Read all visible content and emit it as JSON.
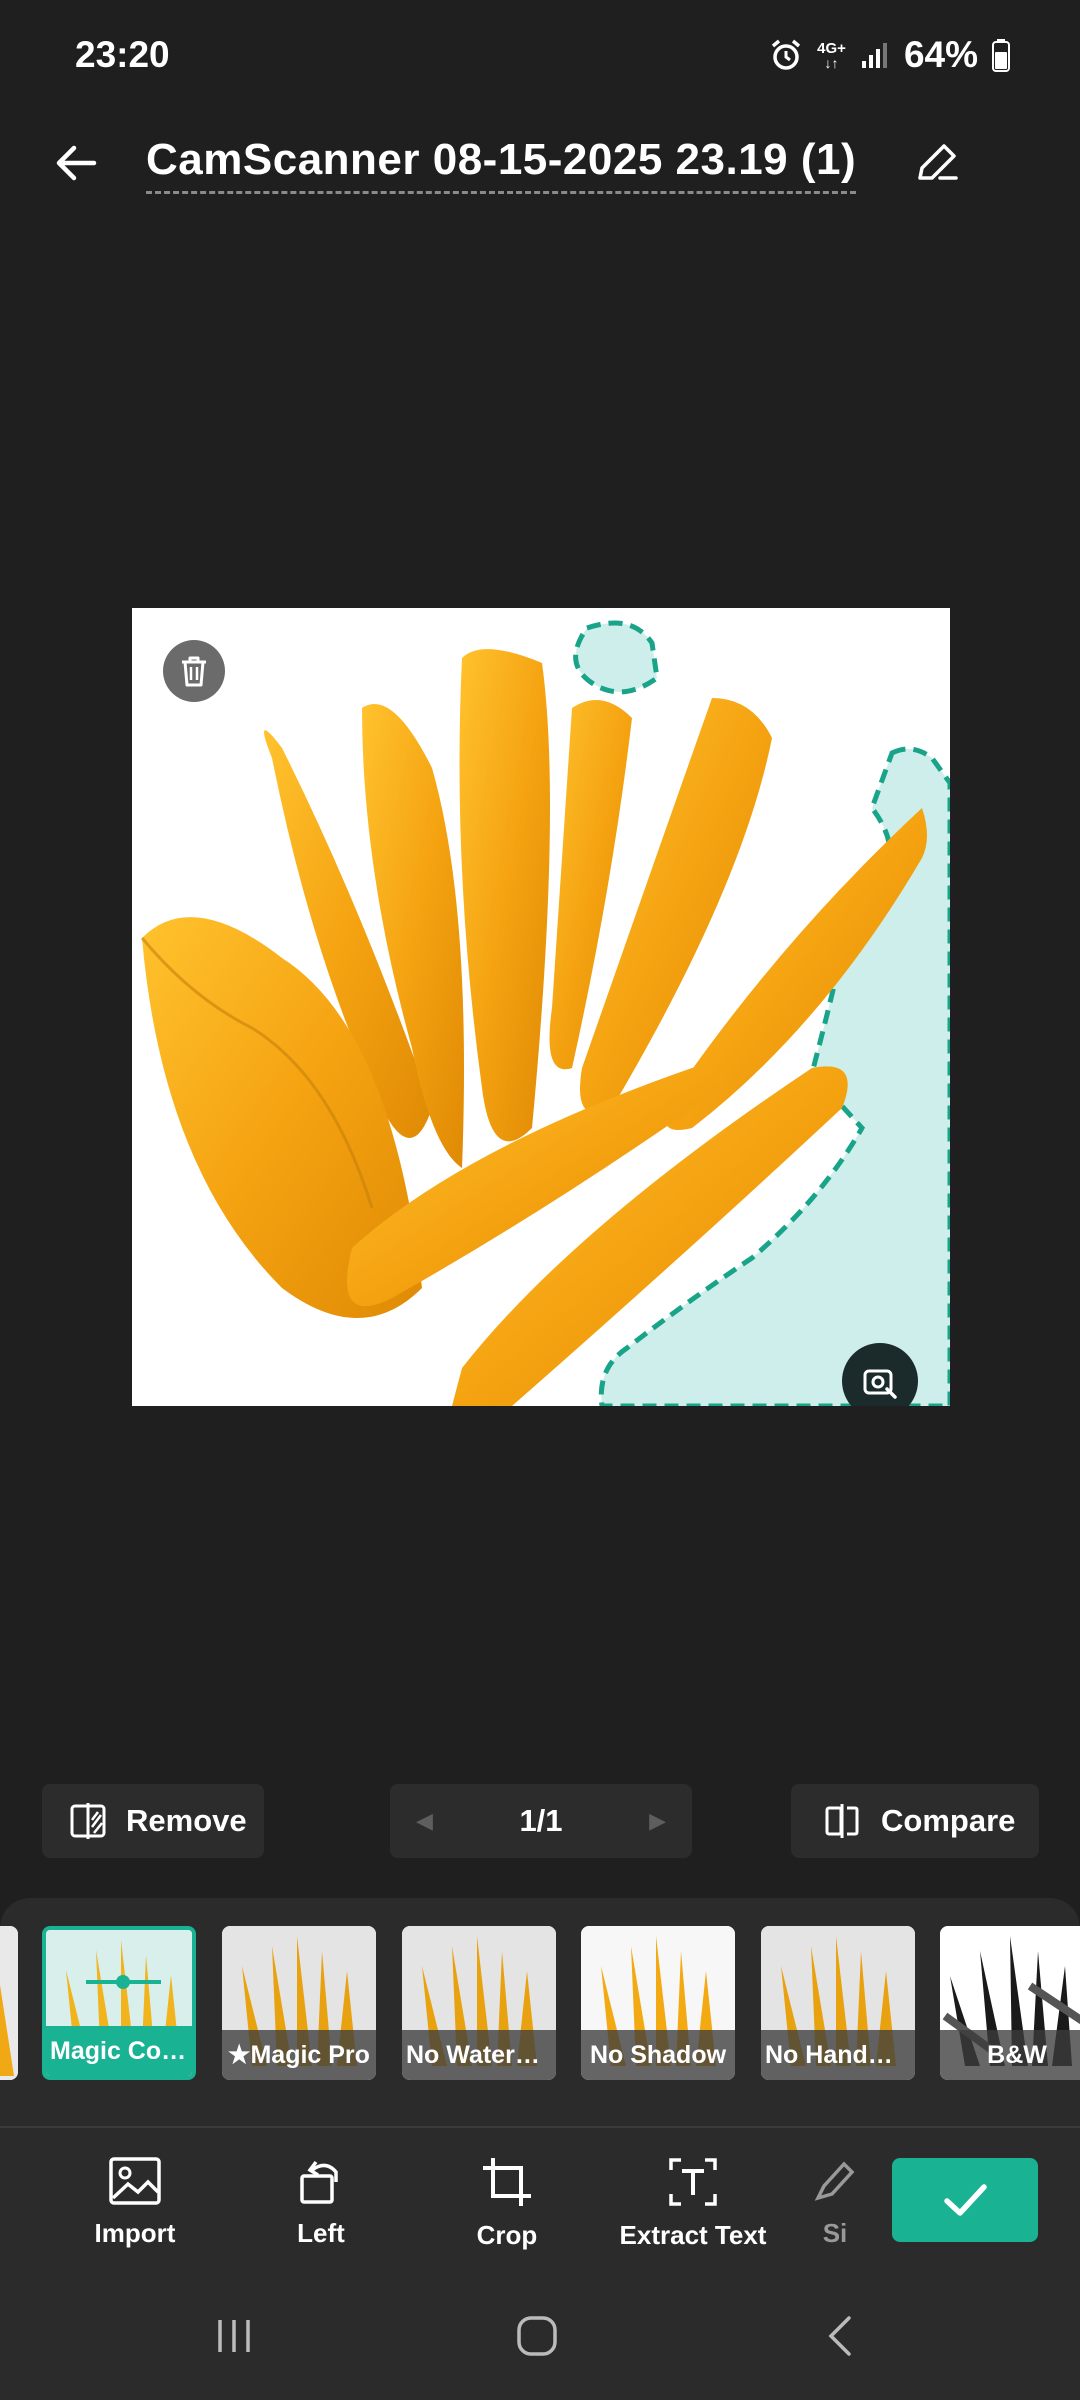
{
  "status_bar": {
    "time": "23:20",
    "network": "4G+",
    "battery": "64%",
    "icons": [
      "alarm-icon",
      "network-4g-icon",
      "signal-icon",
      "battery-icon"
    ]
  },
  "header": {
    "title": "CamScanner 08-15-2025 23.19 (1)",
    "icons": [
      "back-arrow-icon",
      "edit-pencil-icon"
    ]
  },
  "controls": {
    "remove_label": "Remove",
    "page_indicator": "1/1",
    "compare_label": "Compare"
  },
  "filters": [
    {
      "label": "Magic Color",
      "active": true
    },
    {
      "label": "★Magic Pro",
      "active": false
    },
    {
      "label": "No Waterm…",
      "active": false
    },
    {
      "label": "No Shadow",
      "active": false
    },
    {
      "label": "No Handwri…",
      "active": false
    },
    {
      "label": "B&W",
      "active": false
    }
  ],
  "toolbar": {
    "import_label": "Import",
    "left_label": "Left",
    "crop_label": "Crop",
    "extract_label": "Extract Text",
    "partial_label": "Si"
  },
  "colors": {
    "accent": "#19b394",
    "background": "#1f1f1f",
    "panel": "#2b2b2b",
    "selection_fill": "#cdeeea"
  }
}
